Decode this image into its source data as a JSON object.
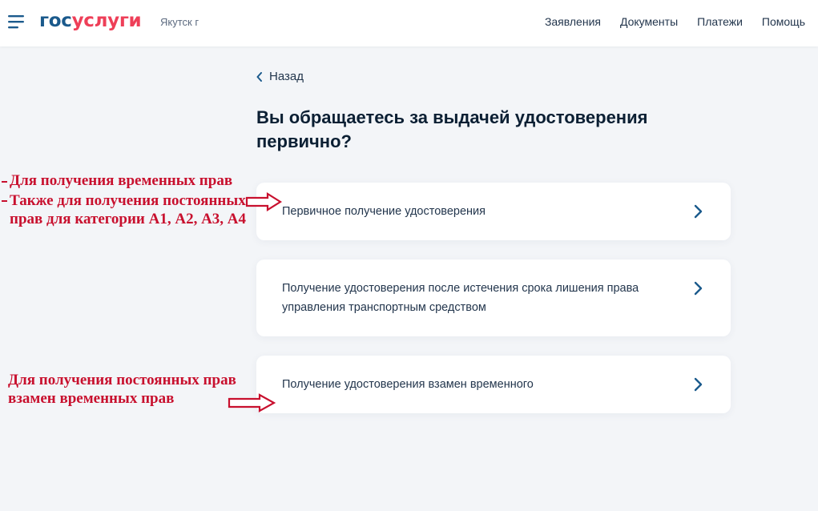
{
  "header": {
    "logo_part1": "гос",
    "logo_part2": "услуги",
    "city": "Якутск г",
    "nav": [
      "Заявления",
      "Документы",
      "Платежи",
      "Помощь"
    ]
  },
  "main": {
    "back_label": "Назад",
    "title": "Вы обращаетесь за выдачей удостоверения первично?",
    "options": [
      "Первичное получение удостоверения",
      "Получение удостоверения после истечения срока лишения права управления транспортным средством",
      "Получение удостоверения взамен временного"
    ]
  },
  "annotations": {
    "note1": "Для получения временных прав",
    "note2": "Также для получения постоянных прав для категории А1, А2, А3, А4",
    "note3": "Для получения постоянных прав взамен временных прав"
  },
  "colors": {
    "brand_blue": "#1b5a8c",
    "brand_red": "#ee3f58",
    "annotation_red": "#c8102e",
    "text_dark": "#0b1f33",
    "background": "#f3f5f8"
  },
  "icons": {
    "menu": "burger-menu-icon",
    "back": "chevron-left-icon",
    "option": "chevron-right-icon",
    "annotation": "hollow-arrow-right-icon"
  }
}
